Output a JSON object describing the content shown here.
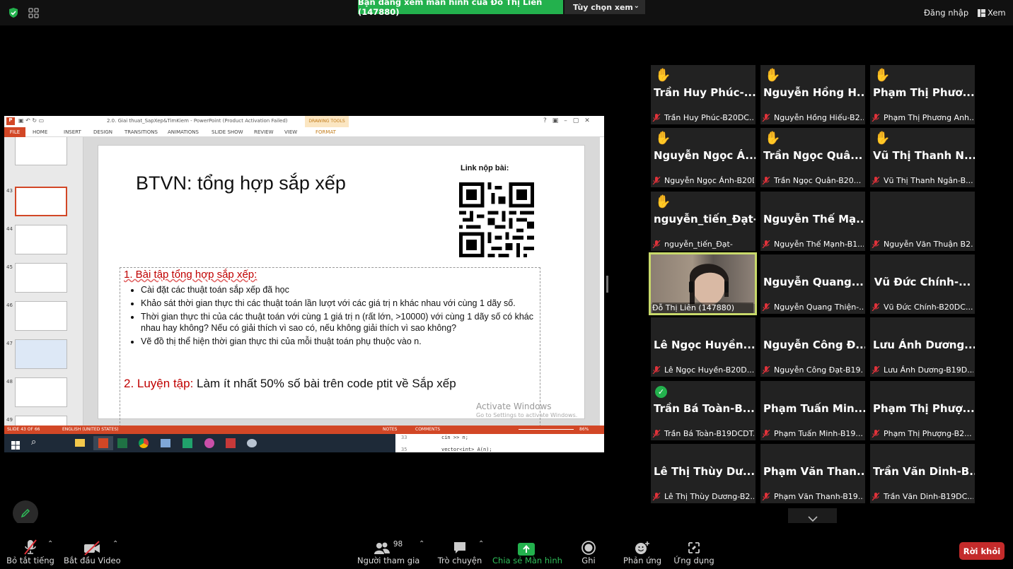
{
  "banner": {
    "text": "Bạn đang xem màn hình của Đỗ Thị Liên (147880)",
    "view_options": "Tùy chọn xem"
  },
  "top": {
    "login": "Đăng nhập",
    "view": "Xem"
  },
  "ppt": {
    "title": "2.0. Giai thuat_SapXep&TimKiem - PowerPoint (Product Activation Failed)",
    "drawing_tools": "DRAWING TOOLS",
    "tabs": [
      "FILE",
      "HOME",
      "INSERT",
      "DESIGN",
      "TRANSITIONS",
      "ANIMATIONS",
      "SLIDE SHOW",
      "REVIEW",
      "VIEW",
      "FORMAT"
    ],
    "thumb_numbers": [
      "43",
      "44",
      "45",
      "46",
      "47",
      "48",
      "49"
    ],
    "slide": {
      "title": "BTVN: tổng hợp sắp xếp",
      "link_label": "Link nộp bài:",
      "item1_heading": "1. Bài tập tổng hợp sắp xếp:",
      "bullets": [
        "Cài đặt các thuật toán sắp xếp đã học",
        "Khảo sát thời gian thực thi các thuật toán lần lượt với các giá trị n khác nhau với cùng 1 dãy số.",
        "Thời gian thực thi của các thuật toán với cùng 1 giá trị n (rất lớn, >10000) với cùng 1 dãy số có khác nhau hay không? Nếu có giải thích vì sao có, nếu không giải thích vì sao không?",
        "Vẽ đồ thị thể hiện thời gian thực thi của mỗi thuật toán phụ thuộc vào n."
      ],
      "item2_heading": "2. Luyện tập:",
      "item2_text": "Làm ít nhất 50% số bài trên code ptit về Sắp xếp",
      "watermark1": "Activate Windows",
      "watermark2": "Go to Settings to activate Windows."
    },
    "status": {
      "slide": "SLIDE 43 OF 66",
      "lang": "ENGLISH (UNITED STATES)",
      "notes": "NOTES",
      "comments": "COMMENTS",
      "zoom": "86%"
    },
    "code": {
      "line1_num": "33",
      "line1": "cin >> n;",
      "line2_num": "35",
      "line2": "vector<int> A(n);"
    }
  },
  "participants": [
    {
      "name": "Trần Huy Phúc-...",
      "label": "Trần Huy Phúc-B20DC...",
      "hand": "✋"
    },
    {
      "name": "Nguyễn Hồng H...",
      "label": "Nguyễn Hồng Hiếu-B2...",
      "hand": "✋"
    },
    {
      "name": "Phạm Thị Phươ...",
      "label": "Phạm Thị Phương Anh...",
      "hand": "✋"
    },
    {
      "name": "Nguyễn Ngọc Á...",
      "label": "Nguyễn Ngọc Ánh-B20DC...",
      "hand": "✋"
    },
    {
      "name": "Trần Ngọc Quâ...",
      "label": "Trần Ngọc  Quân-B20...",
      "hand": "✋"
    },
    {
      "name": "Vũ Thị Thanh   N...",
      "label": "Vũ Thị Thanh  Ngân-B...",
      "hand": "✋"
    },
    {
      "name": "nguyễn_tiến_Đạt-",
      "label": "nguyễn_tiến_Đạt-",
      "hand": "✋"
    },
    {
      "name": "Nguyễn Thế Mạ...",
      "label": "Nguyễn Thế Mạnh-B1...",
      "hand": ""
    },
    {
      "name": "",
      "label": "Nguyễn Văn Thuận B2...",
      "hand": ""
    },
    {
      "name": "",
      "label": "Đỗ Thị Liên (147880)",
      "hand": "",
      "video": true
    },
    {
      "name": "Nguyễn Quang...",
      "label": "Nguyễn Quang Thiện-...",
      "hand": ""
    },
    {
      "name": "Vũ Đức  Chính-...",
      "label": "Vũ Đức  Chính-B20DC...",
      "hand": ""
    },
    {
      "name": "Lê Ngọc  Huyền...",
      "label": "Lê Ngọc  Huyền-B20D...",
      "hand": ""
    },
    {
      "name": "Nguyễn Công Đ...",
      "label": "Nguyễn Công Đạt-B19...",
      "hand": ""
    },
    {
      "name": "Lưu Ánh Dương...",
      "label": "Lưu Ánh Dương-B19D...",
      "hand": ""
    },
    {
      "name": "Trần Bá Toàn-B...",
      "label": "Trần Bá Toàn-B19DCDT...",
      "hand": "",
      "check": true
    },
    {
      "name": "Phạm Tuấn Min...",
      "label": "Phạm Tuấn Minh-B19...",
      "hand": ""
    },
    {
      "name": "Phạm Thị  Phượ...",
      "label": "Phạm Thị  Phượng-B2...",
      "hand": ""
    },
    {
      "name": "Lê Thị Thùy Dư...",
      "label": "Lê Thị Thùy Dương-B2...",
      "hand": ""
    },
    {
      "name": "Phạm Văn Than...",
      "label": "Phạm Văn Thanh-B19...",
      "hand": ""
    },
    {
      "name": "Trần Văn Dinh-B...",
      "label": "Trần Văn Dinh-B19DC...",
      "hand": ""
    }
  ],
  "toolbar": {
    "mute": "Bỏ tắt tiếng",
    "video": "Bắt đầu Video",
    "participants": "Người tham gia",
    "participants_count": "98",
    "chat": "Trò chuyện",
    "share": "Chia sẻ Màn hình",
    "record": "Ghi",
    "reactions": "Phản ứng",
    "apps": "Ứng dụng",
    "leave": "Rời khỏi"
  },
  "colors": {
    "share_green": "#23b14d",
    "leave_red": "#c42b2b",
    "active_speaker": "#c8d96a",
    "muted_red": "#e0323a"
  }
}
